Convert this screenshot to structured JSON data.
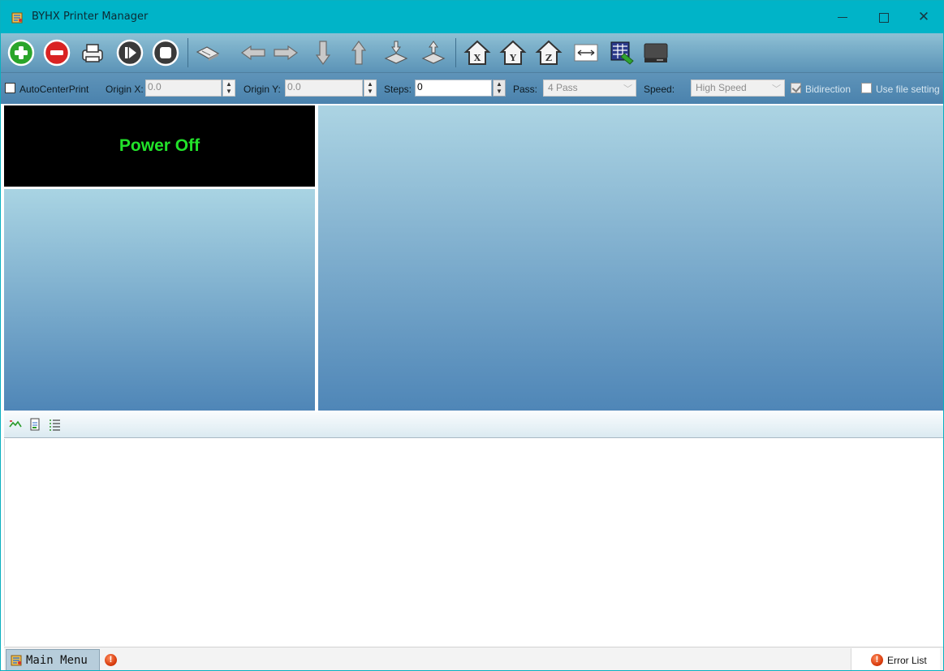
{
  "window": {
    "title": "BYHX  Printer Manager",
    "title_icon": "app-printer-icon",
    "controls": {
      "minimize": "minimize-icon",
      "maximize": "maximize-icon",
      "close": "✕"
    }
  },
  "toolbar": {
    "buttons": [
      {
        "name": "add-icon",
        "color": "#2aa52a"
      },
      {
        "name": "remove-icon",
        "color": "#d92323"
      },
      {
        "name": "print-icon"
      },
      {
        "name": "resume-icon"
      },
      {
        "name": "stop-icon"
      },
      {
        "name": "clean-head-icon"
      },
      {
        "name": "move-left-icon"
      },
      {
        "name": "move-right-icon"
      },
      {
        "name": "move-down-icon"
      },
      {
        "name": "move-up-icon"
      },
      {
        "name": "media-down-icon"
      },
      {
        "name": "media-up-icon"
      },
      {
        "name": "home-x-icon",
        "text": "X"
      },
      {
        "name": "home-y-icon",
        "text": "Y"
      },
      {
        "name": "home-z-icon",
        "text": "Z"
      },
      {
        "name": "measure-width-icon"
      },
      {
        "name": "settings-table-icon"
      },
      {
        "name": "printer-device-icon"
      }
    ]
  },
  "options": {
    "auto_center_label": "AutoCenterPrint",
    "auto_center_checked": false,
    "origin_x_label": "Origin X:",
    "origin_x_value": "0.0",
    "origin_y_label": "Origin Y:",
    "origin_y_value": "0.0",
    "steps_label": "Steps:",
    "steps_value": "0",
    "pass_label": "Pass:",
    "pass_value": "4 Pass",
    "speed_label": "Speed:",
    "speed_value": "High Speed",
    "bidirection_label": "Bidirection",
    "bidirection_checked": true,
    "use_file_setting_label": "Use file setting",
    "use_file_setting_checked": false
  },
  "status_panel": {
    "power_text": "Power Off",
    "power_color": "#22e22a"
  },
  "log_toolbar": {
    "icons": [
      "log-open-icon",
      "log-export-icon",
      "log-list-icon"
    ]
  },
  "statusbar": {
    "main_menu_label": "Main Menu",
    "error_list_label": "Error List",
    "error_icon": "error-icon",
    "error_color": "#d73a0b"
  }
}
